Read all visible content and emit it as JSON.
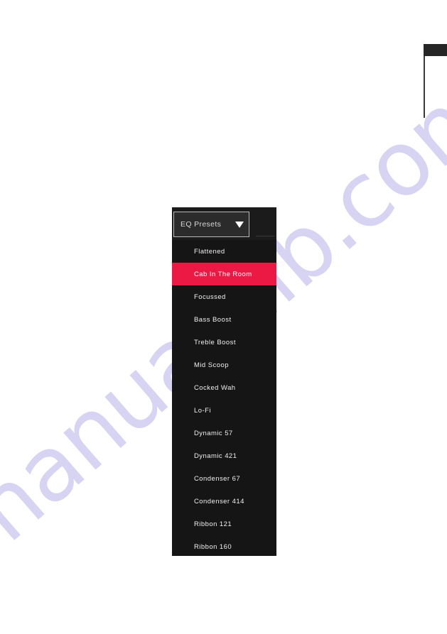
{
  "page": {
    "background_color": "#ffffff",
    "watermark_text": "manualslib.com",
    "watermark_color": "#c9c5ef"
  },
  "corner_marker": {
    "tab_color": "#262626",
    "rule_color": "#3a3a3a"
  },
  "eq_panel": {
    "background_color": "#151515",
    "combo": {
      "label": "EQ Presets",
      "caret_icon": "chevron-down-icon",
      "border_color": "#b9b9b9",
      "fill_color": "#2b2b2b"
    },
    "highlight_color": "#ec1944",
    "selected_preset": "Cab In The Room",
    "presets": [
      {
        "label": "Flattened",
        "selected": false
      },
      {
        "label": "Cab In The Room",
        "selected": true
      },
      {
        "label": "Focussed",
        "selected": false
      },
      {
        "label": "Bass Boost",
        "selected": false
      },
      {
        "label": "Treble Boost",
        "selected": false
      },
      {
        "label": "Mid Scoop",
        "selected": false
      },
      {
        "label": "Cocked Wah",
        "selected": false
      },
      {
        "label": "Lo-Fi",
        "selected": false
      },
      {
        "label": "Dynamic 57",
        "selected": false
      },
      {
        "label": "Dynamic 421",
        "selected": false
      },
      {
        "label": "Condenser 67",
        "selected": false
      },
      {
        "label": "Condenser 414",
        "selected": false
      },
      {
        "label": "Ribbon 121",
        "selected": false
      },
      {
        "label": "Ribbon 160",
        "selected": false
      }
    ]
  }
}
